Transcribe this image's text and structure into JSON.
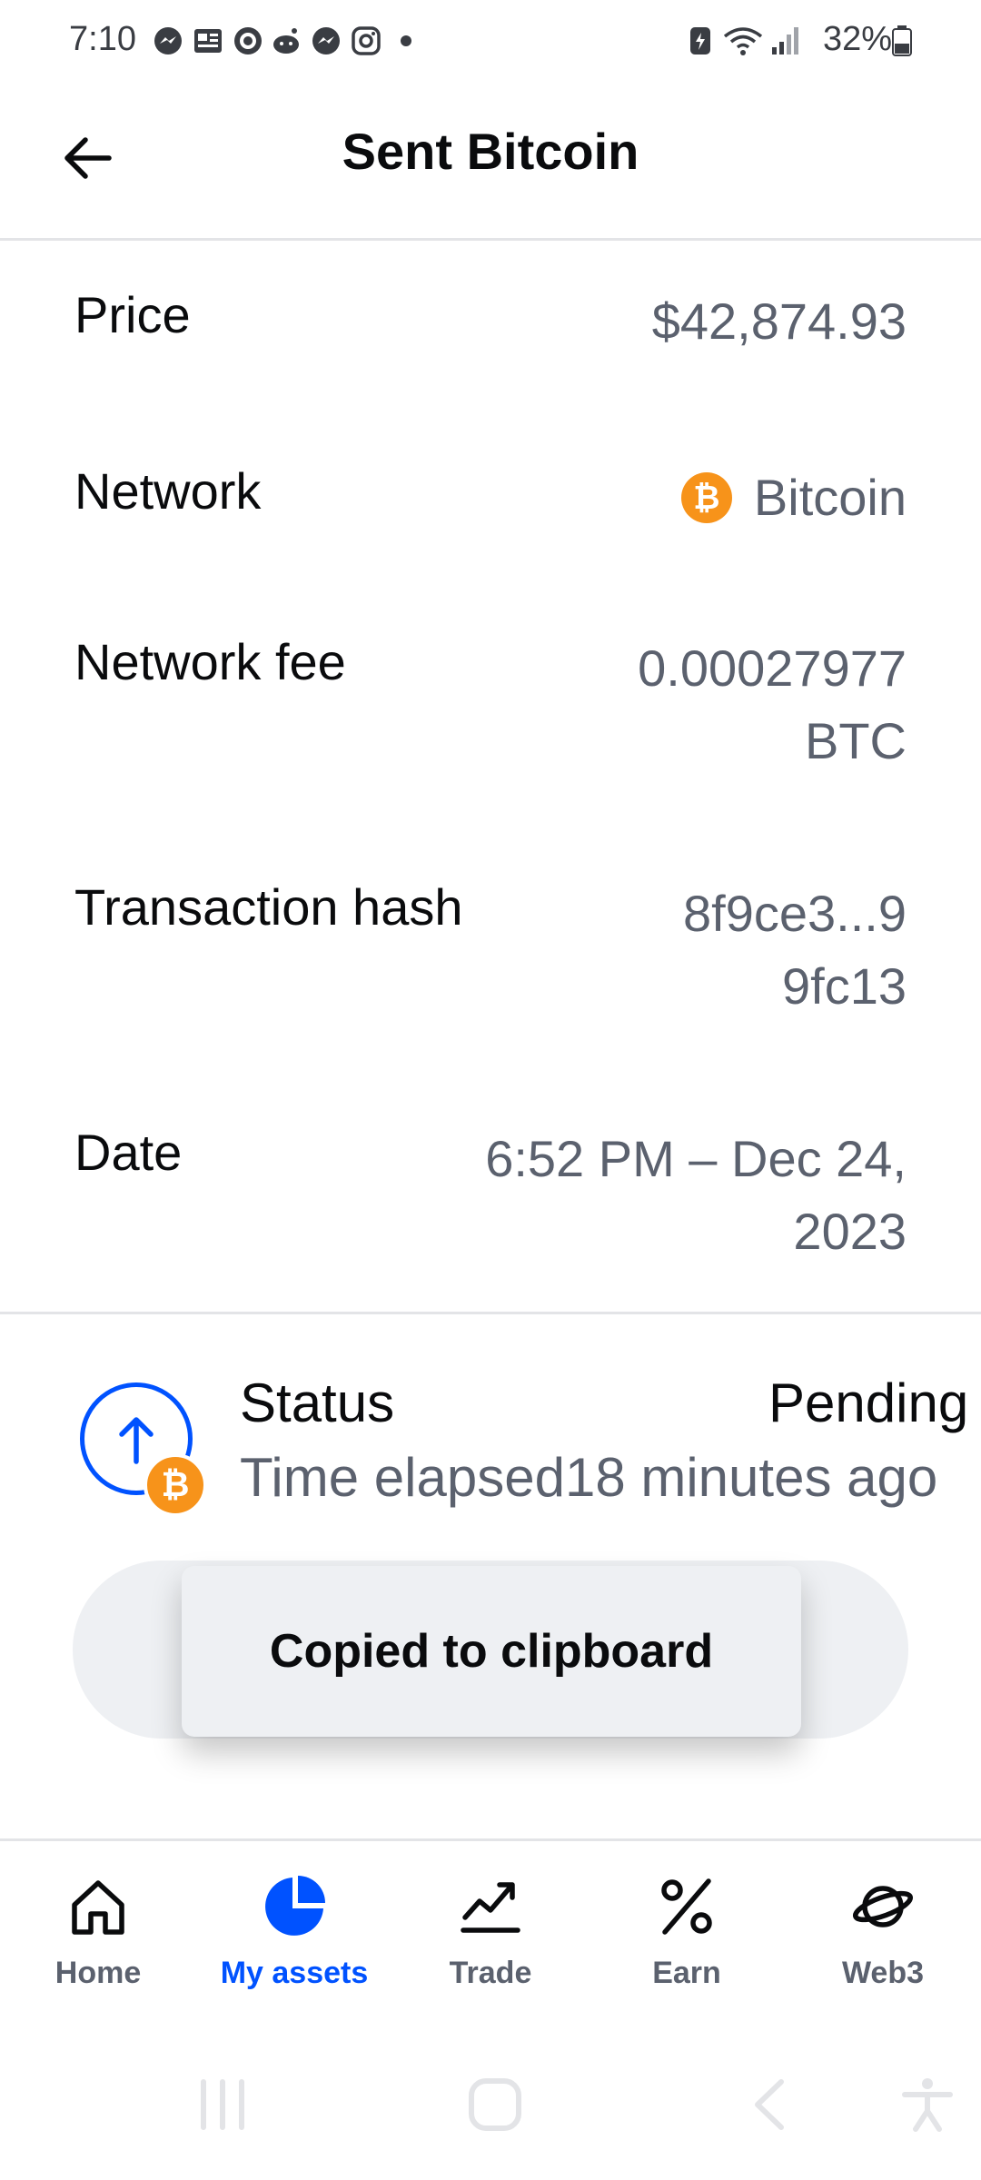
{
  "status_bar": {
    "time": "7:10",
    "battery": "32%"
  },
  "header": {
    "title": "Sent Bitcoin"
  },
  "details": {
    "price_label": "Price",
    "price_value": "$42,874.93",
    "network_label": "Network",
    "network_value": "Bitcoin",
    "network_icon_symbol": "₿",
    "fee_label": "Network fee",
    "fee_value_line1": "0.00027977",
    "fee_value_line2": "BTC",
    "hash_label": "Transaction hash",
    "hash_value_line1": "8f9ce3...9",
    "hash_value_line2": "9fc13",
    "date_label": "Date",
    "date_value_line1": "6:52 PM – Dec 24,",
    "date_value_line2": "2023"
  },
  "status": {
    "label": "Status",
    "value": "Pending",
    "elapsed_label": "Time elapsed",
    "elapsed_value": "18 minutes ago",
    "coin_symbol": "₿"
  },
  "toast": {
    "message": "Copied to clipboard"
  },
  "bottom_nav": {
    "items": [
      {
        "label": "Home",
        "icon": "home-icon"
      },
      {
        "label": "My assets",
        "icon": "pie-chart-icon"
      },
      {
        "label": "Trade",
        "icon": "trending-chart-icon"
      },
      {
        "label": "Earn",
        "icon": "percent-icon"
      },
      {
        "label": "Web3",
        "icon": "planet-icon"
      }
    ],
    "active_color": "#0052ff",
    "inactive_color": "#5b616e"
  },
  "colors": {
    "accent": "#0052ff",
    "bitcoin": "#f7931a",
    "secondary_text": "#5b616e"
  }
}
